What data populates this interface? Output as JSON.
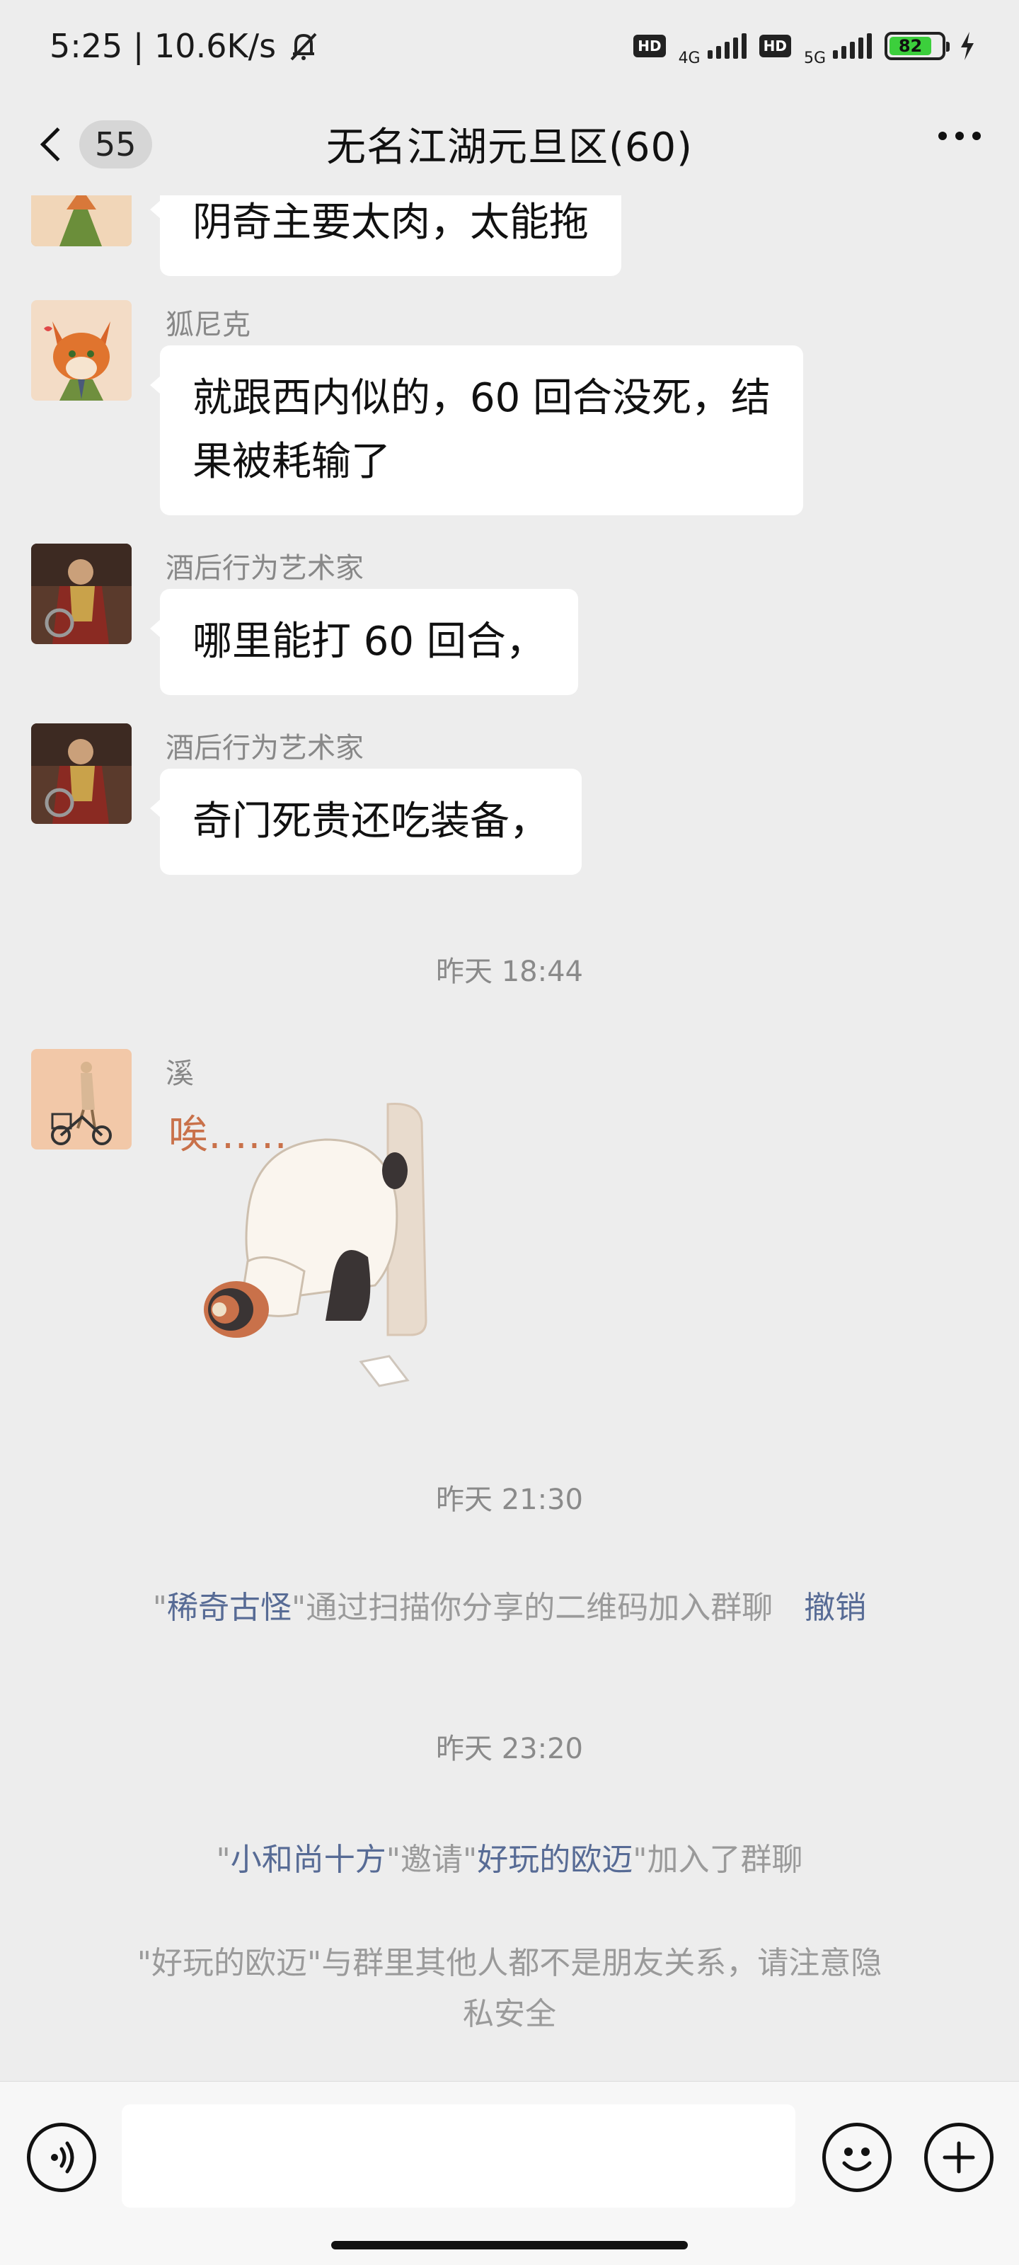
{
  "status_bar": {
    "time_speed": "5:25 | 10.6K/s",
    "net1": "4G",
    "net2": "5G",
    "hd": "HD",
    "battery": "82"
  },
  "header": {
    "unread_count": "55",
    "title": "无名江湖元旦区(60)"
  },
  "messages": [
    {
      "sender": "",
      "text": "阴奇主要太肉，太能拖"
    },
    {
      "sender": "狐尼克",
      "text_lines": [
        "就跟西内似的，60 回合没死，结",
        "果被耗输了"
      ]
    },
    {
      "sender": "酒后行为艺术家",
      "text": "哪里能打 60 回合，"
    },
    {
      "sender": "酒后行为艺术家",
      "text": "奇门死贵还吃装备，"
    },
    {
      "sender": "溪",
      "sticker_text": "唉……"
    }
  ],
  "times": [
    "昨天 18:44",
    "昨天 21:30",
    "昨天 23:20"
  ],
  "system": {
    "join_qr": {
      "q1": "\"",
      "name": "稀奇古怪",
      "q2": "\"",
      "rest": "通过扫描你分享的二维码加入群聊",
      "action": "撤销"
    },
    "invite": {
      "q1": "\"",
      "inviter": "小和尚十方",
      "mid": "\"邀请\"",
      "invitee": "好玩的欧迈",
      "q2": "\"",
      "rest": "加入了群聊"
    },
    "warning_lines": [
      "\"好玩的欧迈\"与群里其他人都不是朋友关系，请注意隐",
      "私安全"
    ]
  },
  "input": {
    "value": ""
  }
}
